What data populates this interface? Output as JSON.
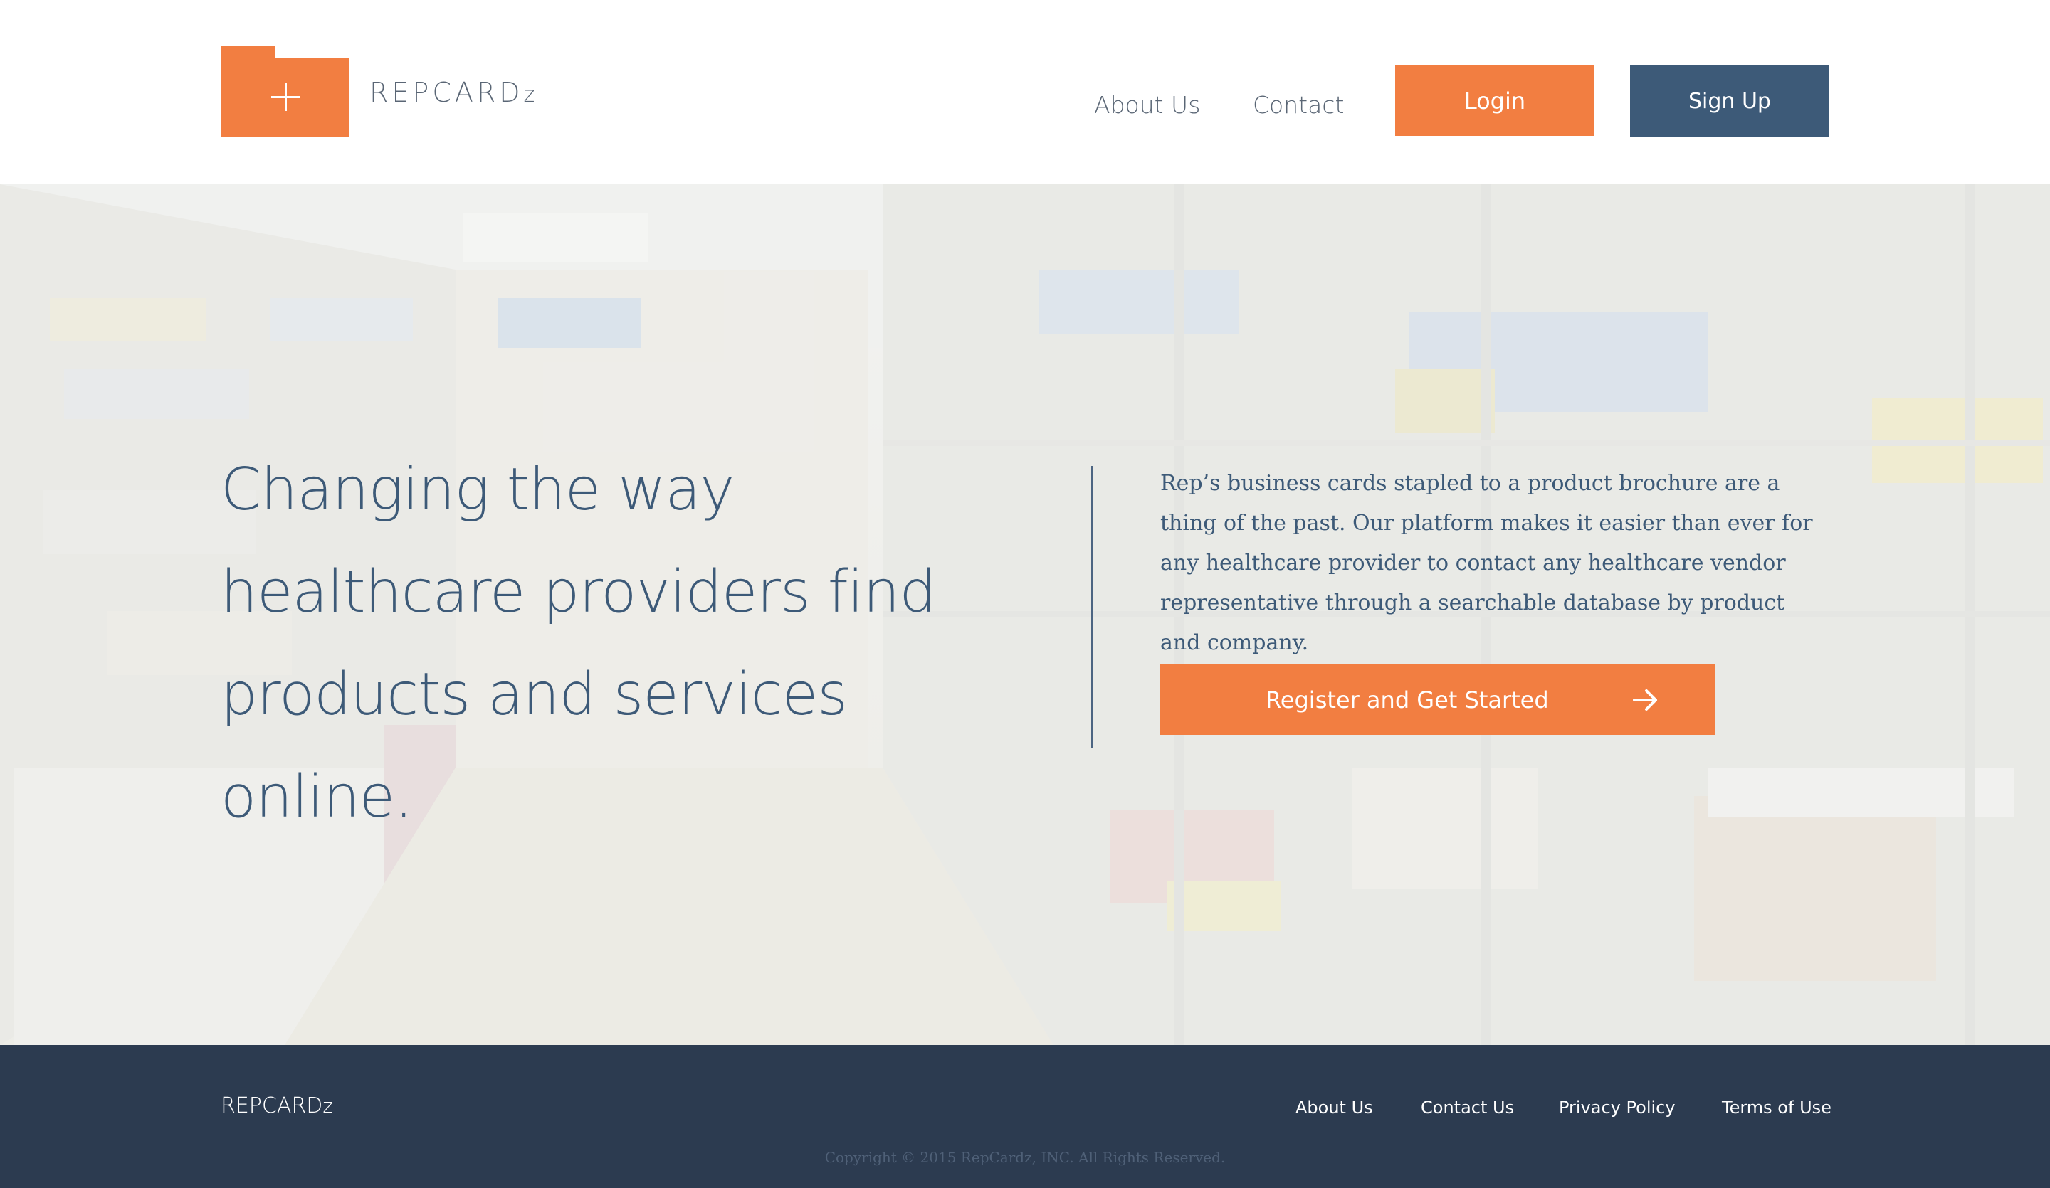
{
  "header": {
    "brand_main": "REPCARD",
    "brand_suffix": "z",
    "nav": {
      "about_label": "About Us",
      "contact_label": "Contact"
    },
    "login_label": "Login",
    "signup_label": "Sign Up"
  },
  "hero": {
    "heading": "Changing the way healthcare providers find products and services online.",
    "description": "Rep’s business cards stapled to a product brochure are a thing of the past. Our platform makes it easier than ever for any healthcare provider to contact any healthcare vendor representative through a searchable database by product and company.",
    "cta_label": "Register and Get Started",
    "cta_icon": "arrow-right-icon",
    "background": "medical-supply-room-photo"
  },
  "footer": {
    "brand_main": "REPCARD",
    "brand_suffix": "z",
    "links": {
      "about": "About Us",
      "contact": "Contact Us",
      "privacy": "Privacy Policy",
      "terms": "Terms of Use"
    },
    "copyright": "Copyright © 2015 RepCardz, INC. All Rights Reserved."
  },
  "colors": {
    "accent_orange": "#f27e41",
    "navy": "#3d5a78",
    "footer_bg": "#2c3b50"
  }
}
